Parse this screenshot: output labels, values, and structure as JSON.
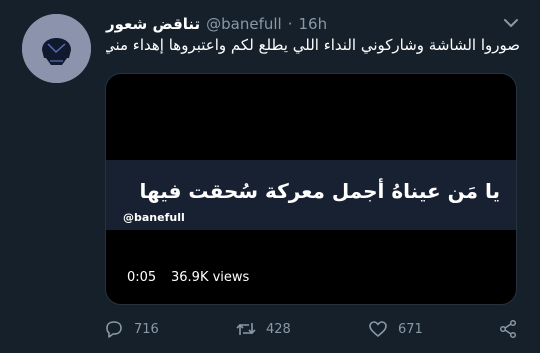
{
  "tweet": {
    "display_name": "تناقض شعور",
    "handle": "@banefull",
    "separator": "·",
    "time": "16h",
    "text": "صوروا الشاشة وشاركوني النداء اللي يطلع لكم واعتبروها إهداء مني 🦋:",
    "media": {
      "caption": "يا مَن عيناهُ أجمل معركة سُحقت فيها",
      "watermark": "@banefull",
      "time": "0:05",
      "views": "36.9K views"
    },
    "actions": {
      "reply_count": "716",
      "retweet_count": "428",
      "like_count": "671"
    }
  },
  "colors": {
    "background": "#15202b",
    "secondary_text": "#8899a6",
    "avatar": "#8c94ad"
  },
  "icons": {
    "menu": "chevron-down-icon",
    "reply": "reply-icon",
    "retweet": "retweet-icon",
    "like": "heart-icon",
    "share": "share-icon"
  }
}
